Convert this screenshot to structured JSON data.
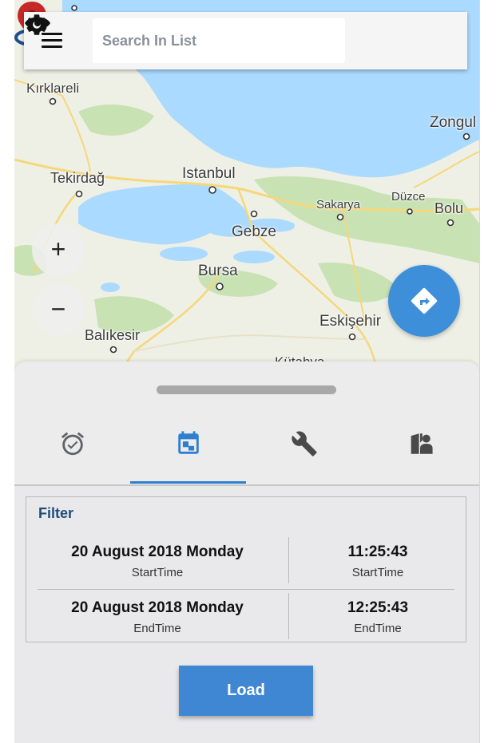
{
  "header": {
    "search_placeholder": "Search In List",
    "menu_icon": "menu-icon",
    "visibility_icon": "eye-icon",
    "settings_icon": "gear-icon"
  },
  "map": {
    "zoom_in_label": "+",
    "zoom_out_label": "−",
    "cities": {
      "kirklareli": "Kırklareli",
      "zonguldak": "Zongul",
      "tekirdag": "Tekirdağ",
      "istanbul": "Istanbul",
      "sakarya": "Sakarya",
      "duzce": "Düzce",
      "bolu": "Bolu",
      "gebze": "Gebze",
      "bursa": "Bursa",
      "eskisehir": "Eskişehir",
      "balikesir": "Balıkesir",
      "kutahya": "Kütahya"
    },
    "colors": {
      "water": "#aadaff",
      "land": "#eef0e6",
      "green": "#c8e2b4",
      "road": "#f6d77a",
      "pin": "#c62828",
      "accent": "#3d8fd9"
    }
  },
  "tabs": [
    {
      "icon": "alarm-check-icon"
    },
    {
      "icon": "calendar-icon",
      "selected": true
    },
    {
      "icon": "wrench-icon"
    },
    {
      "icon": "map-person-icon"
    }
  ],
  "filter": {
    "title": "Filter",
    "start_date": "20 August 2018 Monday",
    "start_date_label": "StartTime",
    "start_time": "11:25:43",
    "start_time_label": "StartTime",
    "end_date": "20 August 2018 Monday",
    "end_date_label": "EndTime",
    "end_time": "12:25:43",
    "end_time_label": "EndTime"
  },
  "load_button": {
    "label": "Load"
  }
}
